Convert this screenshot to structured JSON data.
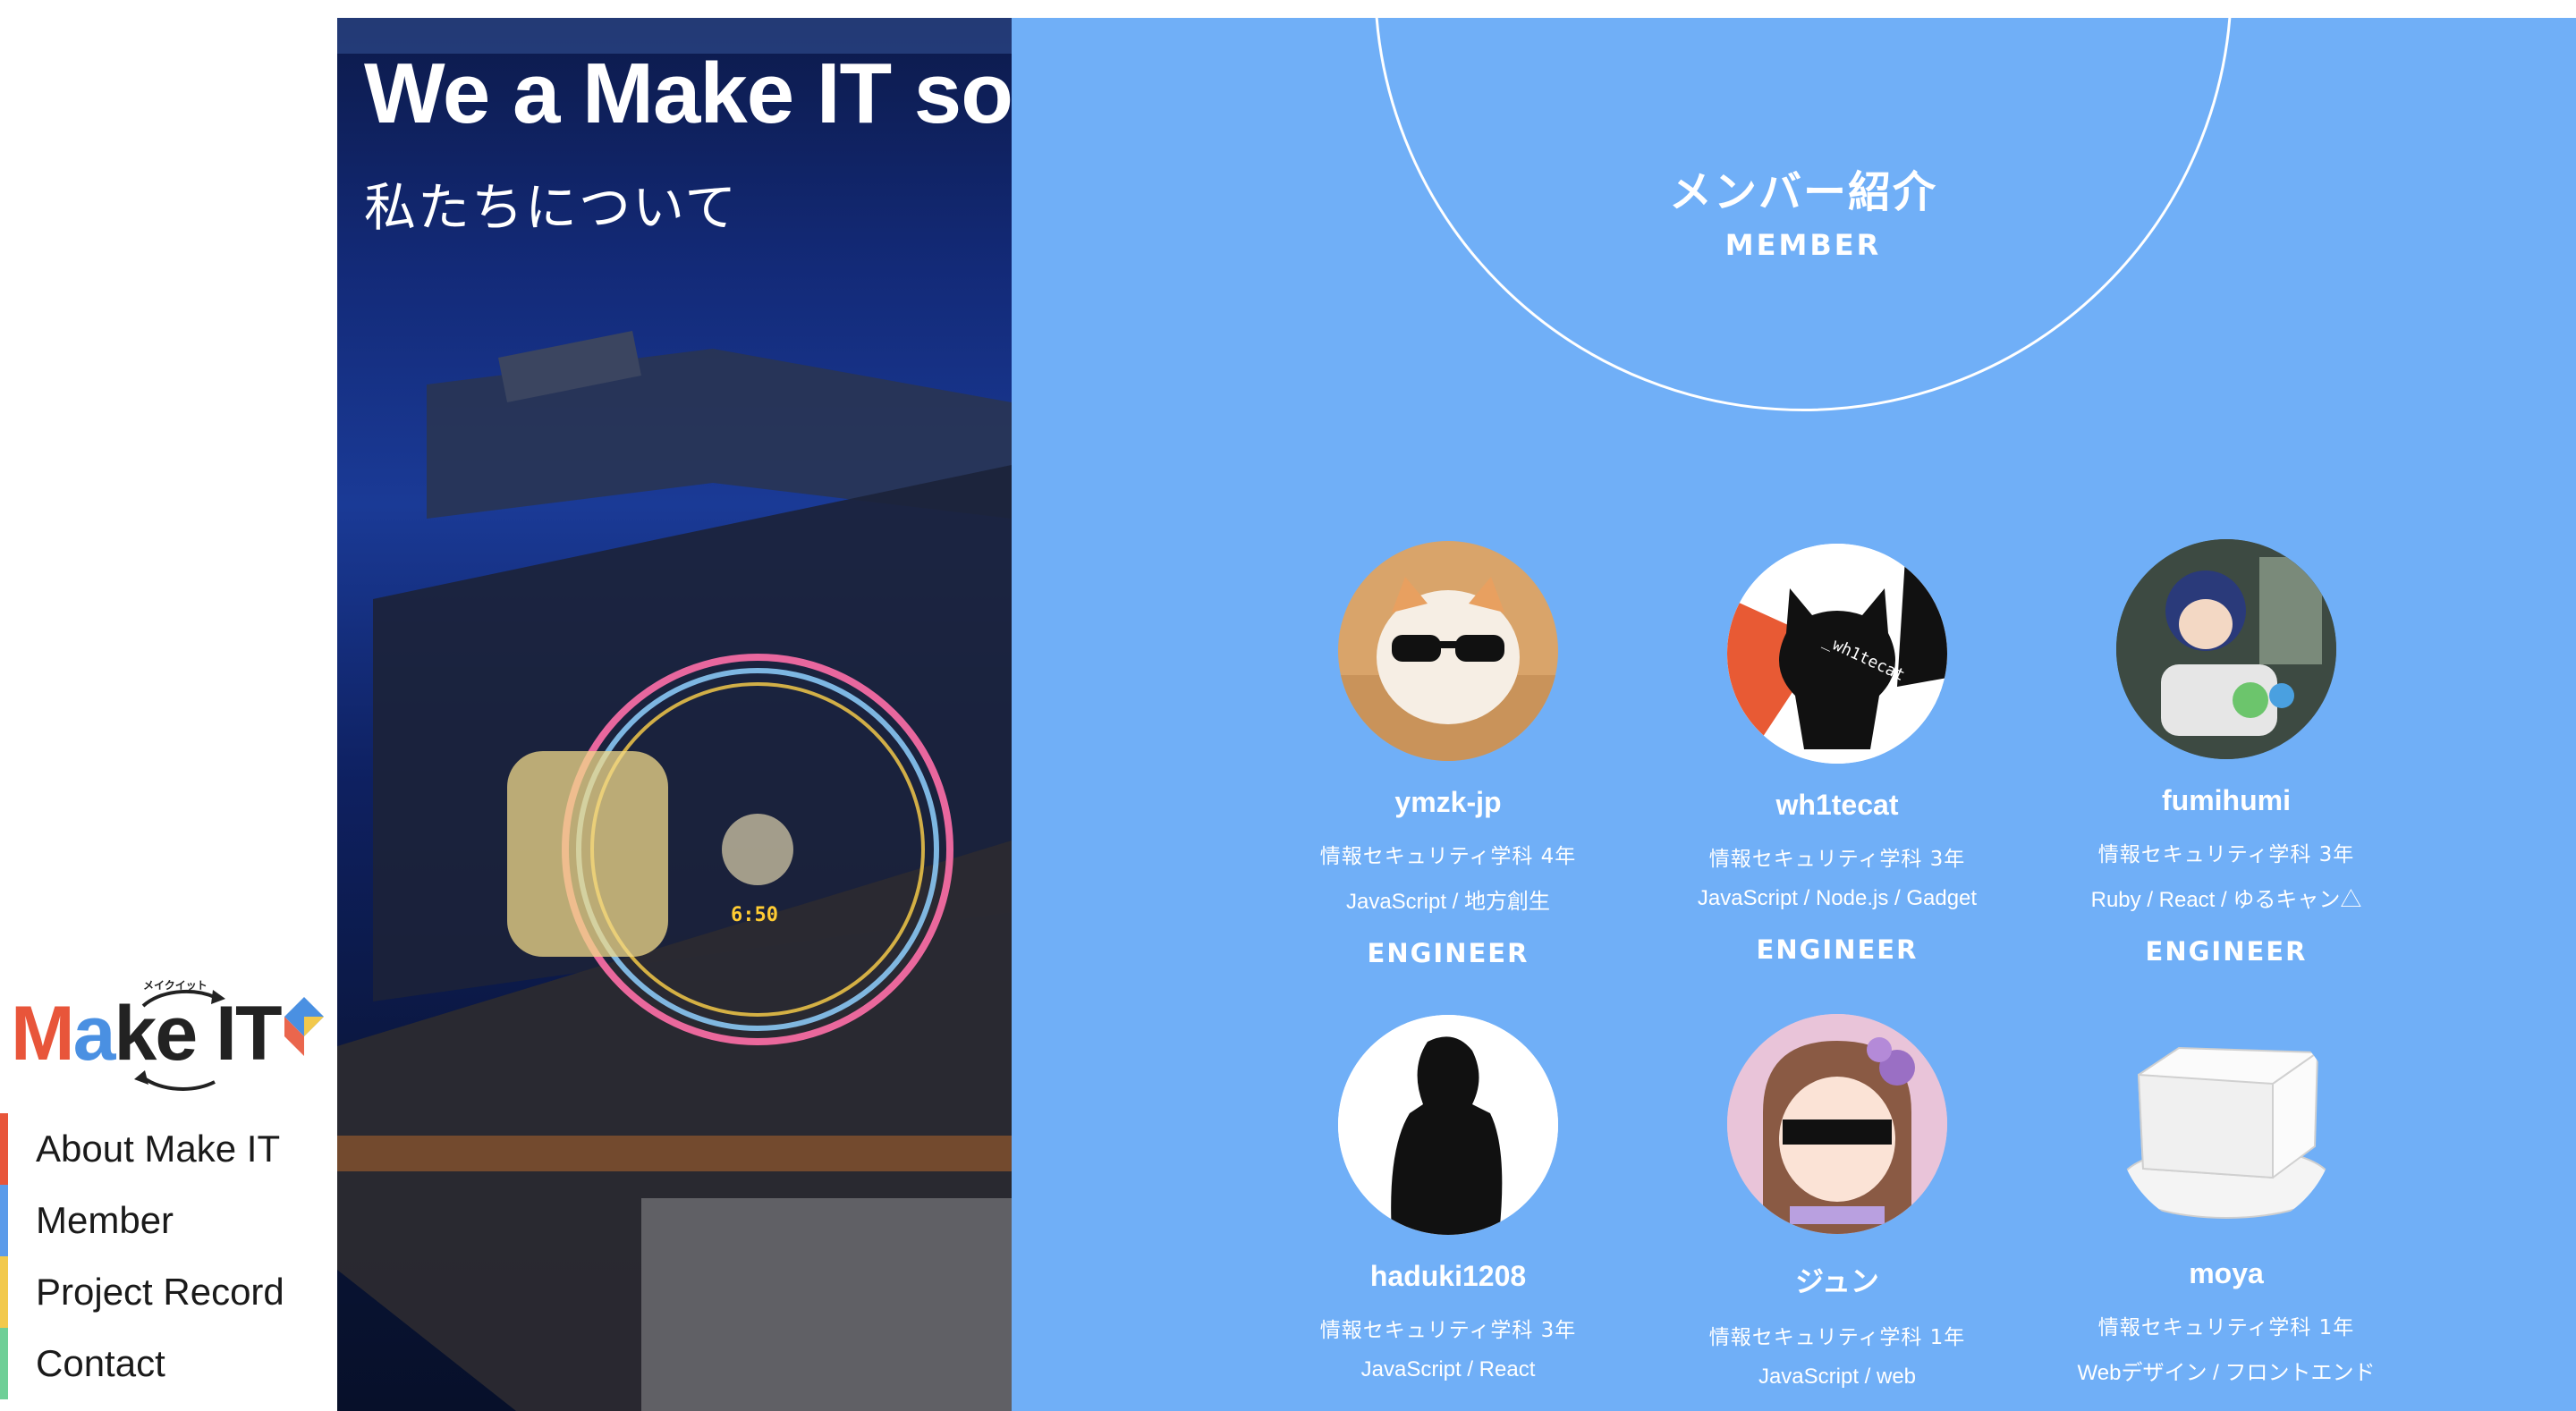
{
  "sidebar": {
    "logo_text": "Make IT",
    "logo_sub": "メイクイット",
    "nav": [
      {
        "label": "About Make IT",
        "color": "#e8553a"
      },
      {
        "label": "Member",
        "color": "#5b9bea"
      },
      {
        "label": "Project Record",
        "color": "#f2c94c"
      },
      {
        "label": "Contact",
        "color": "#6fcf97"
      }
    ]
  },
  "hero": {
    "title": "We a Make IT soldier.",
    "subtitle": "私たちについて",
    "clock": "6:50"
  },
  "members_section": {
    "title": "メンバー紹介",
    "subtitle": "MEMBER",
    "members": [
      {
        "name": "ymzk-jp",
        "dept": "情報セキュリティ学科 4年",
        "skills": "JavaScript / 地方創生",
        "role": "ENGINEER",
        "avatar": "cat-sunglasses-icon"
      },
      {
        "name": "wh1tecat",
        "dept": "情報セキュリティ学科 3年",
        "skills": "JavaScript / Node.js / Gadget",
        "role": "ENGINEER",
        "avatar": "octocat-icon",
        "avatar_text": "_wh1tecat"
      },
      {
        "name": "fumihumi",
        "dept": "情報セキュリティ学科 3年",
        "skills": "Ruby / React / ゆるキャン△",
        "role": "ENGINEER",
        "avatar": "figure-photo-icon"
      },
      {
        "name": "haduki1208",
        "dept": "情報セキュリティ学科 3年",
        "skills": "JavaScript / React",
        "role": "ENGINEER",
        "avatar": "silhouette-icon"
      },
      {
        "name": "ジュン",
        "dept": "情報セキュリティ学科 1年",
        "skills": "JavaScript / web",
        "role": "",
        "avatar": "anime-girl-icon"
      },
      {
        "name": "moya",
        "dept": "情報セキュリティ学科 1年",
        "skills": "Webデザイン / フロントエンド",
        "role": "",
        "avatar": "tofu-icon"
      }
    ]
  },
  "colors": {
    "panel": "#70aff7",
    "logo_red": "#e8553a",
    "logo_blue": "#4a90e2",
    "logo_yellow": "#f2c94c",
    "logo_green": "#6fcf97"
  }
}
